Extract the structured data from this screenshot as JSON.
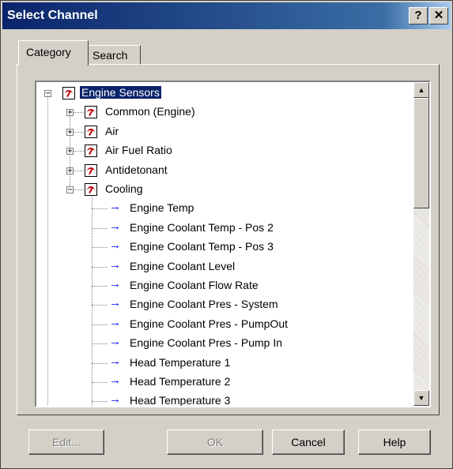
{
  "window": {
    "title": "Select Channel",
    "help_glyph": "?",
    "close_glyph": "✕"
  },
  "tabs": [
    {
      "label": "Category"
    },
    {
      "label": "Search"
    }
  ],
  "tree": {
    "root": {
      "label": "Engine Sensors",
      "expander": "−"
    },
    "categories": [
      {
        "label": "Common (Engine)",
        "expander": "+"
      },
      {
        "label": "Air",
        "expander": "+"
      },
      {
        "label": "Air Fuel Ratio",
        "expander": "+"
      },
      {
        "label": "Antidetonant",
        "expander": "+"
      },
      {
        "label": "Cooling",
        "expander": "−"
      }
    ],
    "channels": [
      "Engine Temp",
      "Engine Coolant Temp - Pos 2",
      "Engine Coolant Temp - Pos 3",
      "Engine Coolant Level",
      "Engine Coolant Flow Rate",
      "Engine Coolant Pres - System",
      "Engine Coolant Pres - PumpOut",
      "Engine Coolant Pres - Pump In",
      "Head Temperature 1",
      "Head Temperature 2",
      "Head Temperature 3"
    ],
    "arrow_glyph": "→",
    "scroll_up_glyph": "▲",
    "scroll_down_glyph": "▼"
  },
  "buttons": {
    "edit": "Edit...",
    "ok": "OK",
    "cancel": "Cancel",
    "help": "Help"
  }
}
